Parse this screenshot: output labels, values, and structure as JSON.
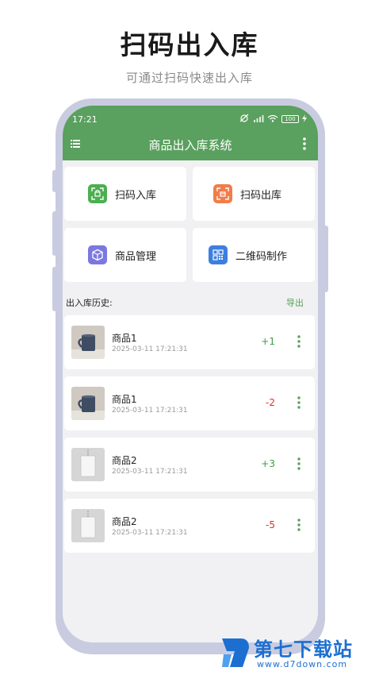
{
  "promo": {
    "headline": "扫码出入库",
    "subline": "可通过扫码快速出入库"
  },
  "status_bar": {
    "time": "17:21",
    "battery": "100"
  },
  "app_bar": {
    "title": "商品出入库系统",
    "menu_icon": "menu-icon",
    "more_icon": "more-vert-icon"
  },
  "tiles": [
    {
      "label": "扫码入库",
      "icon": "scan-in-icon",
      "color": "#4caf50"
    },
    {
      "label": "扫码出库",
      "icon": "scan-out-icon",
      "color": "#f07d4a"
    },
    {
      "label": "商品管理",
      "icon": "box-icon",
      "color": "#7b78e0"
    },
    {
      "label": "二维码制作",
      "icon": "qr-code-icon",
      "color": "#3d7fe0"
    }
  ],
  "history": {
    "title": "出入库历史:",
    "export_label": "导出",
    "items": [
      {
        "name": "商品1",
        "date": "2025-03-11 17:21:31",
        "qty": "+1",
        "thumb": "mug-thumbnail"
      },
      {
        "name": "商品1",
        "date": "2025-03-11 17:21:31",
        "qty": "-2",
        "thumb": "mug-thumbnail"
      },
      {
        "name": "商品2",
        "date": "2025-03-11 17:21:31",
        "qty": "+3",
        "thumb": "tag-thumbnail"
      },
      {
        "name": "商品2",
        "date": "2025-03-11 17:21:31",
        "qty": "-5",
        "thumb": "tag-thumbnail"
      }
    ]
  },
  "colors": {
    "primary": "#5aa05e",
    "positive": "#3f9b46",
    "negative": "#e0302c"
  },
  "watermark": {
    "text": "第七下载站",
    "url": "www.d7down.com"
  }
}
